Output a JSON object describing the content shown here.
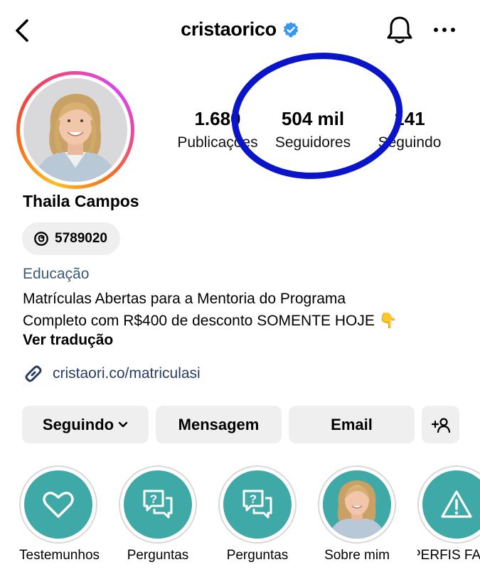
{
  "header": {
    "username": "cristaorico"
  },
  "profile": {
    "display_name": "Thaila Campos",
    "threads_badge": "5789020",
    "category": "Educação",
    "bio_line1": "Matrículas Abertas para a Mentoria do Programa",
    "bio_line2": "Completo com R$400 de desconto SOMENTE HOJE 👇",
    "translate_label": "Ver tradução",
    "link": "cristaori.co/matriculasi"
  },
  "stats": [
    {
      "value": "1.680",
      "label": "Publicações"
    },
    {
      "value": "504 mil",
      "label": "Seguidores"
    },
    {
      "value": "141",
      "label": "Seguindo"
    }
  ],
  "buttons": {
    "following": "Seguindo",
    "message": "Mensagem",
    "email": "Email"
  },
  "highlights": [
    {
      "label": "Testemunhos",
      "icon": "heart-icon"
    },
    {
      "label": "Perguntas",
      "icon": "question-chat-icon"
    },
    {
      "label": "Perguntas",
      "icon": "question-chat-icon"
    },
    {
      "label": "Sobre mim",
      "icon": "photo"
    },
    {
      "label": "PERFIS FA",
      "icon": "warning-icon"
    }
  ],
  "colors": {
    "annotation": "#0a14c8",
    "highlight_bg": "#3fa9a8",
    "link": "#283c63",
    "verified": "#3897f0"
  }
}
